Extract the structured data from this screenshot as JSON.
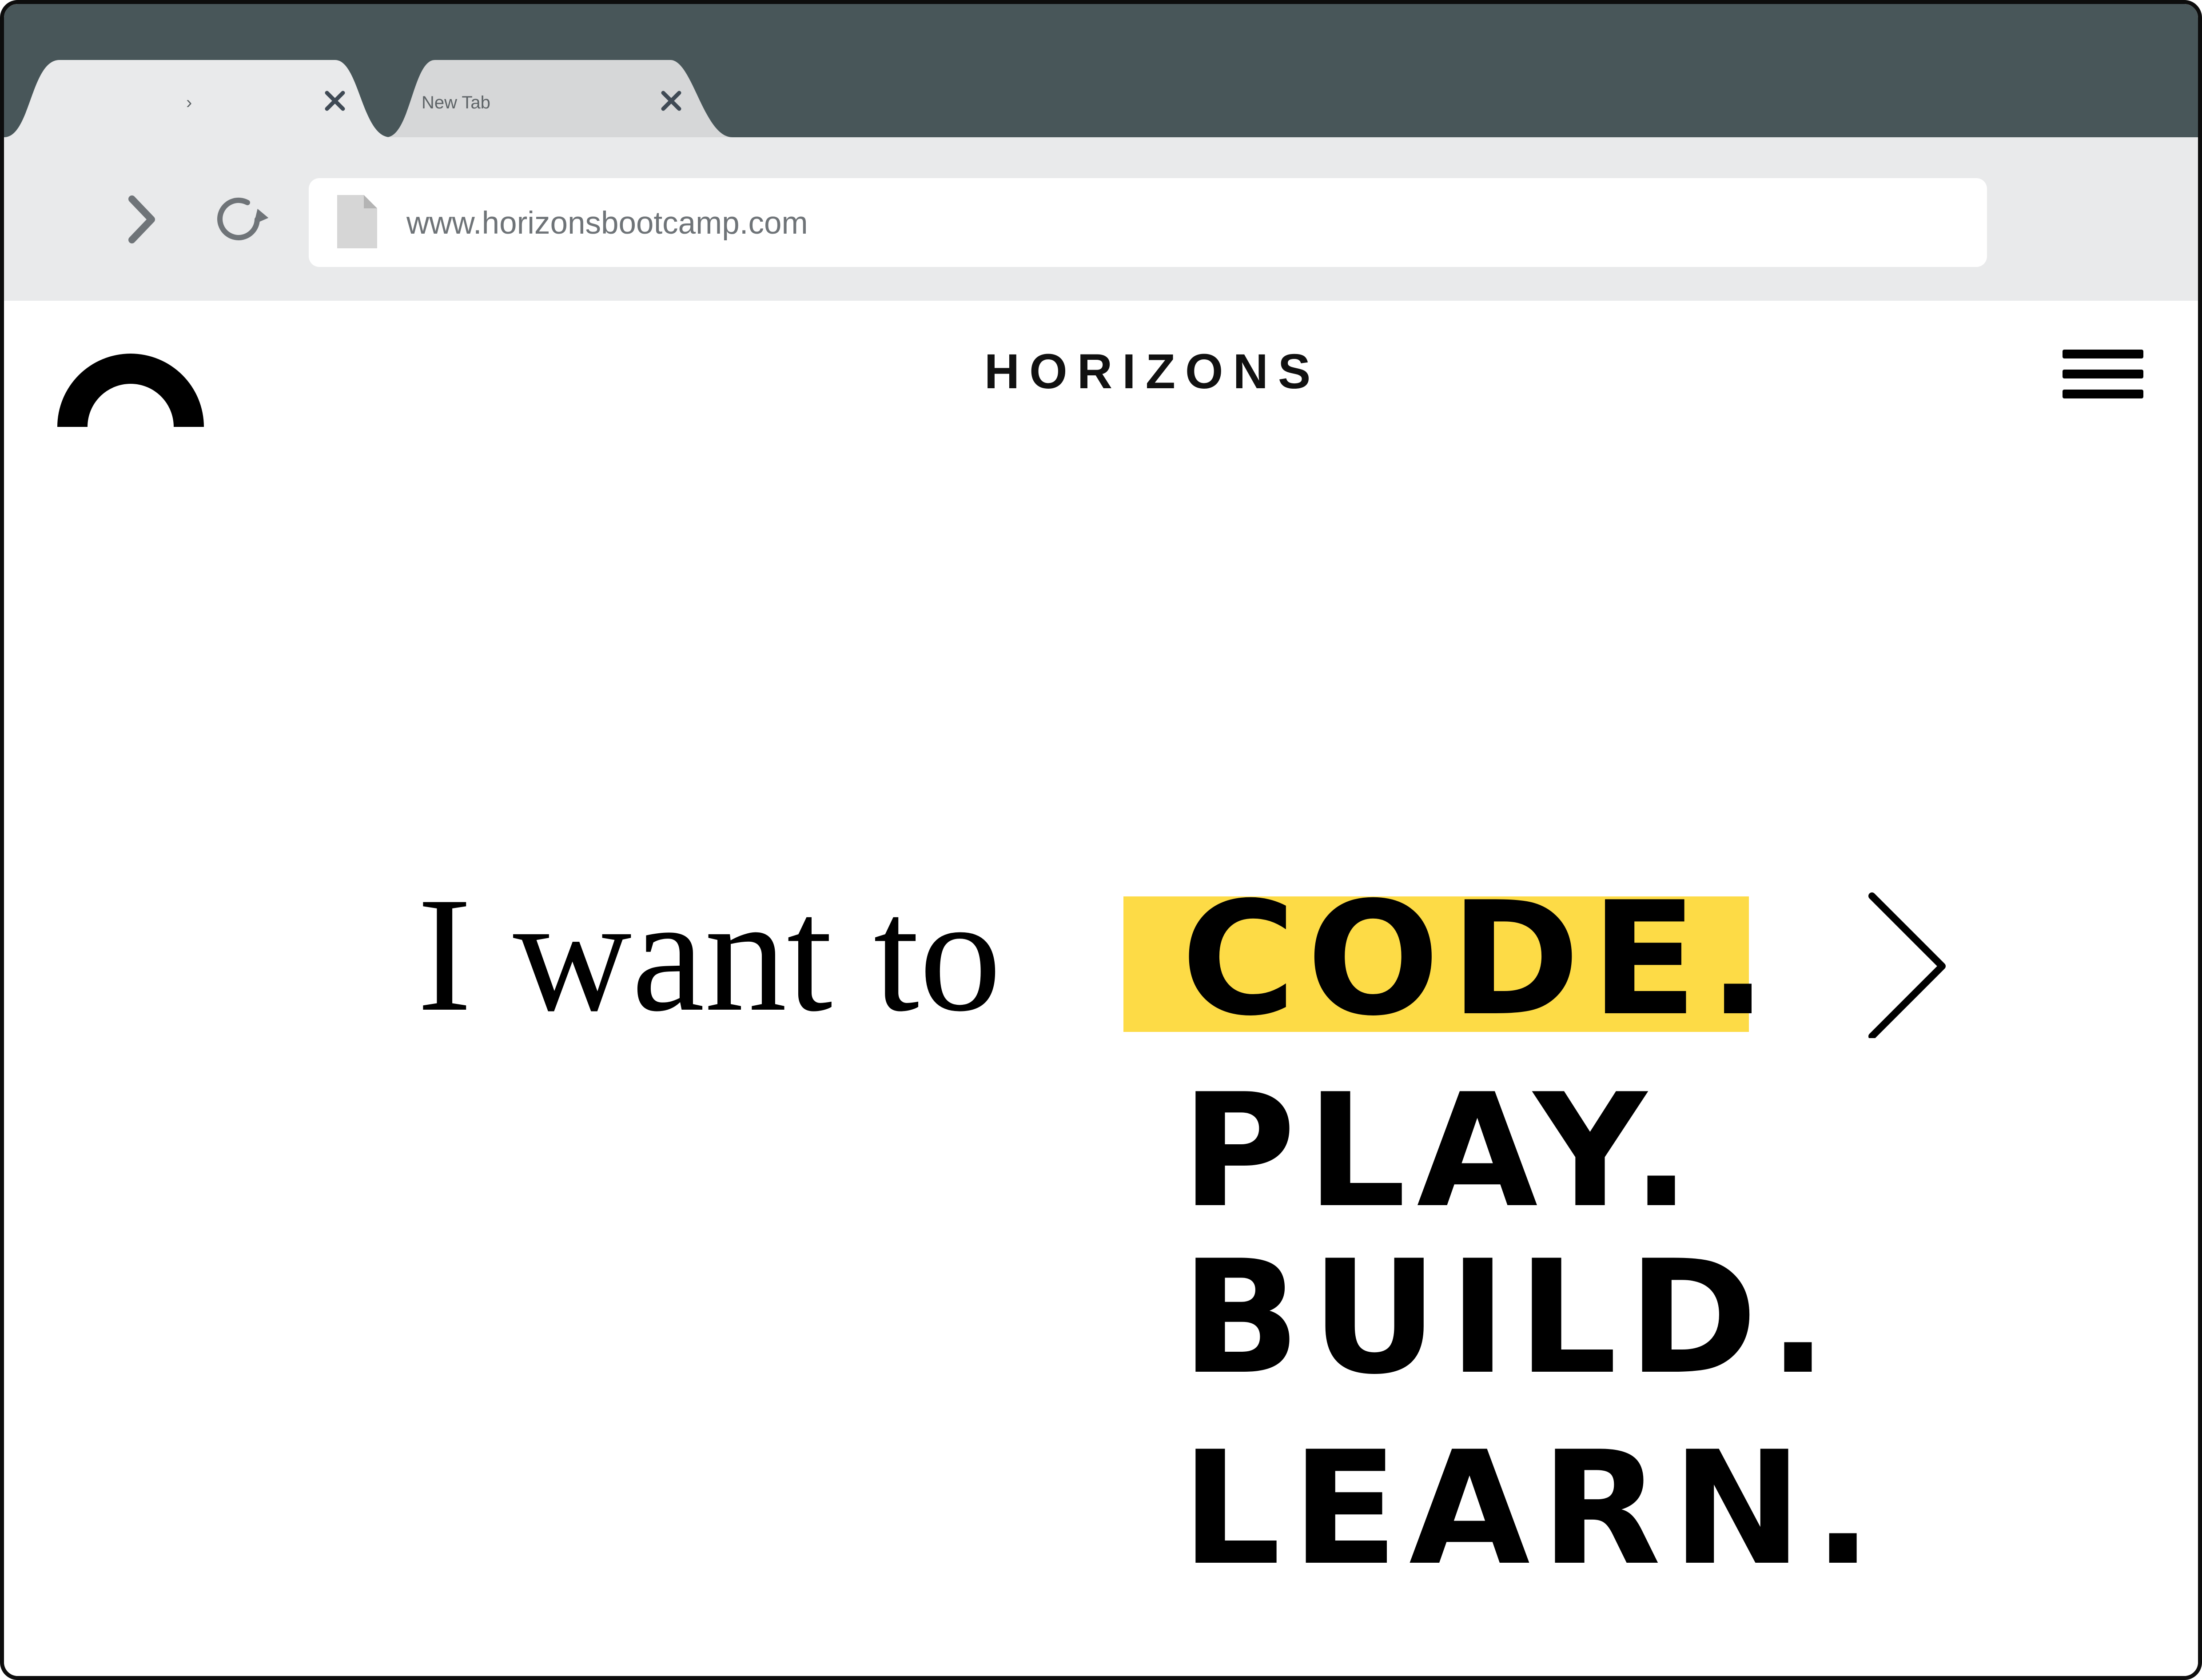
{
  "browser": {
    "tabs": [
      {
        "title": "›"
      },
      {
        "title": "New Tab"
      }
    ],
    "address_bar": {
      "url": "www.horizonsbootcamp.com"
    },
    "icons": [
      "chevron-right-icon",
      "reload-icon",
      "page-icon",
      "close-icon"
    ]
  },
  "site": {
    "brand": "HORIZONS",
    "icons": [
      "horizons-logo-icon",
      "hamburger-menu-icon",
      "chevron-right-icon"
    ],
    "hero": {
      "lead": "I want to",
      "words": [
        "CODE.",
        "PLAY.",
        "BUILD.",
        "LEARN."
      ],
      "highlight_color": "#fddb46"
    }
  },
  "colors": {
    "tab_bar": "#485659",
    "tab_active": "#e9eaeb",
    "tab_inactive": "#d6d7d8",
    "toolbar": "#e9eaeb",
    "text_dark": "#000000"
  }
}
